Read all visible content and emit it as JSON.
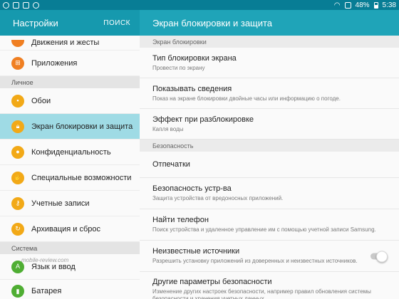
{
  "status_bar": {
    "battery": "48%",
    "time": "5:38"
  },
  "left_header": {
    "title": "Настройки",
    "search": "ПОИСК"
  },
  "right_header": {
    "title": "Экран блокировки и защита"
  },
  "left_panel": {
    "top_items": [
      {
        "label": "Движения и жесты",
        "icon": "motion-icon"
      },
      {
        "label": "Приложения",
        "icon": "apps-icon"
      }
    ],
    "personal_section": "Личное",
    "personal_items": [
      {
        "label": "Обои",
        "icon": "wallpaper-icon"
      },
      {
        "label": "Экран блокировки и защита",
        "icon": "lock-icon",
        "active": true
      },
      {
        "label": "Конфиденциальность",
        "icon": "privacy-icon"
      },
      {
        "label": "Специальные возможности",
        "icon": "accessibility-icon"
      },
      {
        "label": "Учетные записи",
        "icon": "key-icon"
      },
      {
        "label": "Архивация и сброс",
        "icon": "backup-icon"
      }
    ],
    "system_section": "Система",
    "system_items": [
      {
        "label": "Язык и ввод",
        "icon": "language-icon"
      },
      {
        "label": "Батарея",
        "icon": "battery-icon"
      }
    ]
  },
  "right_panel": {
    "lock_section": "Экран блокировки",
    "lock_items": [
      {
        "title": "Тип блокировки экрана",
        "subtitle": "Провести по экрану"
      },
      {
        "title": "Показывать сведения",
        "subtitle": "Показ на экране блокировки двойные часы или информацию о погоде."
      },
      {
        "title": "Эффект при разблокировке",
        "subtitle": "Капля воды"
      }
    ],
    "security_section": "Безопасность",
    "security_items": [
      {
        "title": "Отпечатки"
      },
      {
        "title": "Безопасность устр-ва",
        "subtitle": "Защита устройства от вредоносных приложений."
      },
      {
        "title": "Найти телефон",
        "subtitle": "Поиск устройства и удаленное управление им с помощью учетной записи Samsung."
      },
      {
        "title": "Неизвестные источники",
        "subtitle": "Разрешить установку приложений из доверенных и неизвестных источников.",
        "toggle": false
      },
      {
        "title": "Другие параметры безопасности",
        "subtitle": "Изменение других настроек безопасности, например правил обновления системы безопасности и хранения учетных данных."
      }
    ]
  },
  "watermark": "mobile-review.com",
  "colors": {
    "statusbar": "#087d95",
    "header_left": "#1699ae",
    "header_right": "#1fa4b8",
    "active": "#9fdbe5",
    "icon_orange": "#f07f22",
    "icon_yellow": "#f2a917",
    "icon_green": "#4fae33"
  }
}
